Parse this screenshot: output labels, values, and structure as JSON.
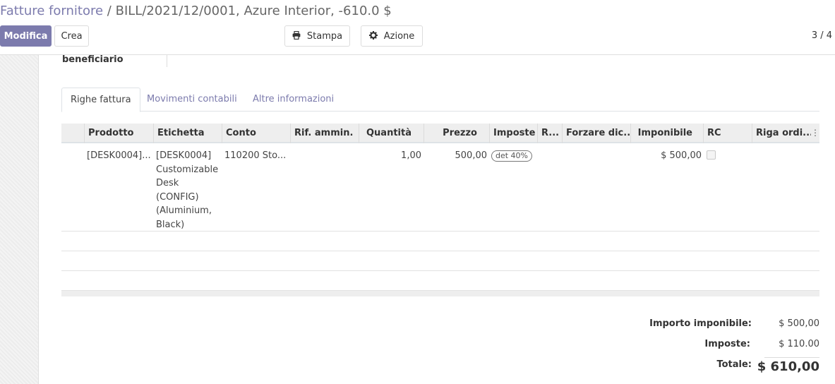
{
  "breadcrumb": {
    "parent": "Fatture fornitore",
    "separator": "/",
    "current": "BILL/2021/12/0001, Azure Interior, -610.0 $"
  },
  "buttons": {
    "edit": "Modifica",
    "create": "Crea",
    "print": "Stampa",
    "action": "Azione"
  },
  "icons": {
    "print": "print-icon",
    "action": "gear-icon"
  },
  "pager": "3 / 4",
  "partial_field_label": "beneficiario",
  "tabs": [
    "Righe fattura",
    "Movimenti contabili",
    "Altre informazioni"
  ],
  "lines": {
    "columns": [
      "Prodotto",
      "Etichetta",
      "Conto",
      "Rif. ammin.",
      "Quantità",
      "Prezzo",
      "Imposte",
      "R...",
      "Forzare dic...",
      "Imponibile",
      "RC",
      "Riga ordi..."
    ],
    "rows": [
      {
        "product": "[DESK0004]...",
        "label": "[DESK0004] Customizable Desk (CONFIG) (Aluminium, Black)",
        "account": "110200 Sto...",
        "analytic": "",
        "quantity": "1,00",
        "price": "500,00",
        "tax": "det 40%",
        "r": "",
        "force": "",
        "subtotal": "$ 500,00",
        "rc": false,
        "order_line": ""
      }
    ]
  },
  "totals": {
    "untaxed_label": "Importo imponibile:",
    "untaxed_value": "$ 500,00",
    "tax_label": "Imposte:",
    "tax_value": "$ 110.00",
    "total_label": "Totale:",
    "total_value": "$ 610,00"
  },
  "colors": {
    "brand": "#7c7bad"
  }
}
